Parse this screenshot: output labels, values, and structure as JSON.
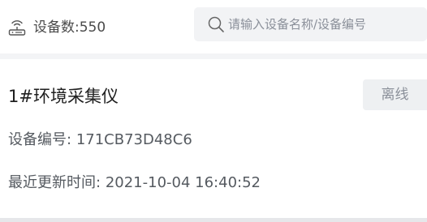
{
  "header": {
    "device_count_label": "设备数:550"
  },
  "search": {
    "placeholder": "请输入设备名称/设备编号"
  },
  "device": {
    "name": "1#环境采集仪",
    "status": "离线",
    "code_label": "设备编号:",
    "code_value": "171CB73D48C6",
    "updated_label": "最近更新时间:",
    "updated_value": "2021-10-04 16:40:52"
  },
  "icons": {
    "router": "router-icon",
    "search": "search-icon"
  },
  "colors": {
    "status_badge_bg": "#eef0f2",
    "status_text": "#8a8f99",
    "background": "#f3f4f6"
  }
}
